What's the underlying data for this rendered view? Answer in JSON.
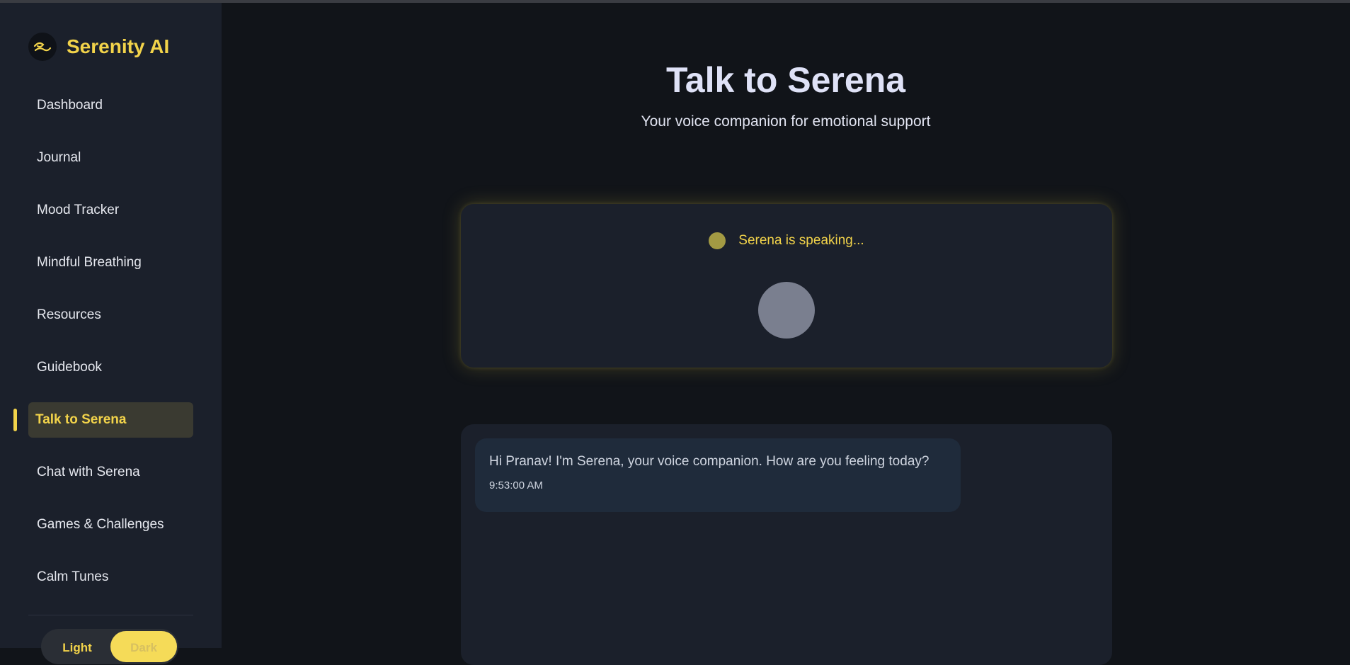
{
  "app": {
    "name": "Serenity AI"
  },
  "sidebar": {
    "items": [
      {
        "label": "Dashboard"
      },
      {
        "label": "Journal"
      },
      {
        "label": "Mood Tracker"
      },
      {
        "label": "Mindful Breathing"
      },
      {
        "label": "Resources"
      },
      {
        "label": "Guidebook"
      },
      {
        "label": "Talk to Serena",
        "active": true
      },
      {
        "label": "Chat with Serena"
      },
      {
        "label": "Games & Challenges"
      },
      {
        "label": "Calm Tunes"
      }
    ],
    "theme_toggle": {
      "light_label": "Light",
      "dark_label": "Dark",
      "selected": "Dark"
    }
  },
  "main": {
    "title": "Talk to Serena",
    "subtitle": "Your voice companion for emotional support",
    "voice_status": "Serena is speaking...",
    "messages": [
      {
        "text": "Hi Pranav! I'm Serena, your voice companion. How are you feeling today?",
        "time": "9:53:00 AM"
      }
    ]
  },
  "colors": {
    "accent": "#f2d34a",
    "background": "#111419",
    "panel": "#1b202b"
  }
}
